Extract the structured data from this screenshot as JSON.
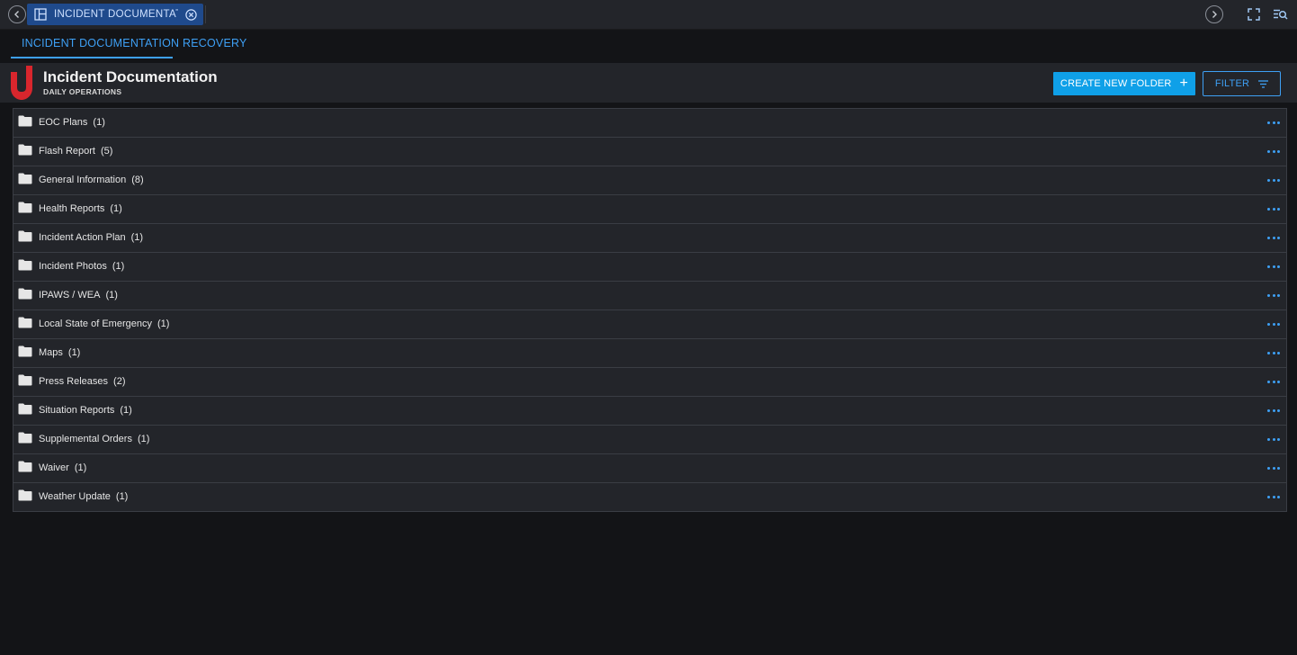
{
  "topbar": {
    "active_tab_label": "INCIDENT DOCUMENTATI...",
    "icons": [
      "chevron-left-icon",
      "layout-icon",
      "close-circle-icon",
      "chevron-right-icon",
      "expand-icon",
      "search-list-icon"
    ]
  },
  "subtabs": [
    {
      "label": "INCIDENT DOCUMENTATION",
      "active": true
    },
    {
      "label": "RECOVERY",
      "active": false
    }
  ],
  "header": {
    "title": "Incident Documentation",
    "subtitle": "DAILY OPERATIONS",
    "create_button_label": "CREATE NEW FOLDER",
    "create_button_icon": "+",
    "filter_button_label": "FILTER"
  },
  "colors": {
    "accent": "#3ea0f5",
    "primary_button": "#0fa0e8",
    "logo_red": "#d9262d",
    "background": "#131417",
    "panel": "#23252a"
  },
  "folders": [
    {
      "name": "EOC Plans",
      "count": "(1)"
    },
    {
      "name": "Flash Report",
      "count": "(5)"
    },
    {
      "name": "General Information",
      "count": "(8)"
    },
    {
      "name": "Health Reports",
      "count": "(1)"
    },
    {
      "name": "Incident Action Plan",
      "count": "(1)"
    },
    {
      "name": "Incident Photos",
      "count": "(1)"
    },
    {
      "name": "IPAWS / WEA",
      "count": "(1)"
    },
    {
      "name": "Local State of Emergency",
      "count": "(1)"
    },
    {
      "name": "Maps",
      "count": "(1)"
    },
    {
      "name": "Press Releases",
      "count": "(2)"
    },
    {
      "name": "Situation Reports",
      "count": "(1)"
    },
    {
      "name": "Supplemental Orders",
      "count": "(1)"
    },
    {
      "name": "Waiver",
      "count": "(1)"
    },
    {
      "name": "Weather Update",
      "count": "(1)"
    }
  ]
}
